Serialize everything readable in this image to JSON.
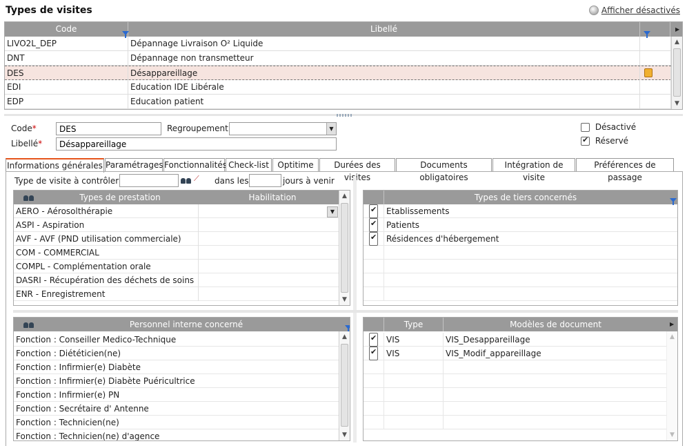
{
  "page": {
    "title": "Types de visites",
    "show_deactivated": "Afficher désactivés"
  },
  "top_grid": {
    "headers": {
      "code": "Code",
      "label": "Libellé"
    },
    "rows": [
      {
        "code": "LIVO2L_DEP",
        "label": "Dépannage Livraison O² Liquide"
      },
      {
        "code": "DNT",
        "label": "Dépannage non transmetteur"
      },
      {
        "code": "DES",
        "label": "Désappareillage",
        "selected": true,
        "locked": true
      },
      {
        "code": "EDI",
        "label": "Education IDE Libérale"
      },
      {
        "code": "EDP",
        "label": "Education patient"
      }
    ]
  },
  "form": {
    "code_label": "Code",
    "code_value": "DES",
    "regroupement_label": "Regroupement",
    "regroupement_value": "",
    "libelle_label": "Libellé",
    "libelle_value": "Désappareillage",
    "required_mark": "*",
    "desactive_label": "Désactivé",
    "desactive_checked": false,
    "reserve_label": "Réservé",
    "reserve_checked": true
  },
  "tabs": [
    {
      "label": "Informations générales",
      "active": true
    },
    {
      "label": "Paramétrages"
    },
    {
      "label": "Fonctionnalités"
    },
    {
      "label": "Check-list"
    },
    {
      "label": "Optitime"
    },
    {
      "label": "Durées des visites"
    },
    {
      "label": "Documents obligatoires"
    },
    {
      "label": "Intégration de visite"
    },
    {
      "label": "Préférences de passage"
    }
  ],
  "general": {
    "type_visite_label": "Type de visite à contrôler",
    "type_visite_value": "",
    "dans_les": "dans les",
    "jours_value": "",
    "jours_a_venir": "jours à venir"
  },
  "prestation_grid": {
    "headers": {
      "type": "Types de prestation",
      "habilitation": "Habilitation"
    },
    "rows": [
      "AERO - Aérosolthérapie",
      "ASPI - Aspiration",
      "AVF - AVF (PND utilisation commerciale)",
      "COM - COMMERCIAL",
      "COMPL - Complémentation orale",
      "DASRI - Récupération des déchets de soins",
      "ENR - Enregistrement"
    ]
  },
  "tiers_grid": {
    "header": "Types de tiers concernés",
    "rows": [
      {
        "label": "Etablissements",
        "checked": true
      },
      {
        "label": "Patients",
        "checked": true
      },
      {
        "label": "Résidences d'hébergement",
        "checked": true
      }
    ]
  },
  "personnel_grid": {
    "header": "Personnel interne concerné",
    "rows": [
      "Fonction : Conseiller Medico-Technique",
      "Fonction : Diététicien(ne)",
      "Fonction : Infirmier(e) Diabète",
      "Fonction : Infirmier(e) Diabète Puéricultrice",
      "Fonction : Infirmier(e) PN",
      "Fonction : Secrétaire d' Antenne",
      "Fonction : Technicien(ne)",
      "Fonction : Technicien(ne) d'agence"
    ]
  },
  "documents_grid": {
    "headers": {
      "type": "Type",
      "model": "Modèles de document"
    },
    "rows": [
      {
        "type": "VIS",
        "model": "VIS_Desappareillage",
        "checked": true
      },
      {
        "type": "VIS",
        "model": "VIS_Modif_appareillage",
        "checked": true
      }
    ]
  },
  "colors": {
    "header_bg": "#9a9a9a",
    "active_tab": "#e5531a",
    "selected_row": "#f6e4df"
  }
}
